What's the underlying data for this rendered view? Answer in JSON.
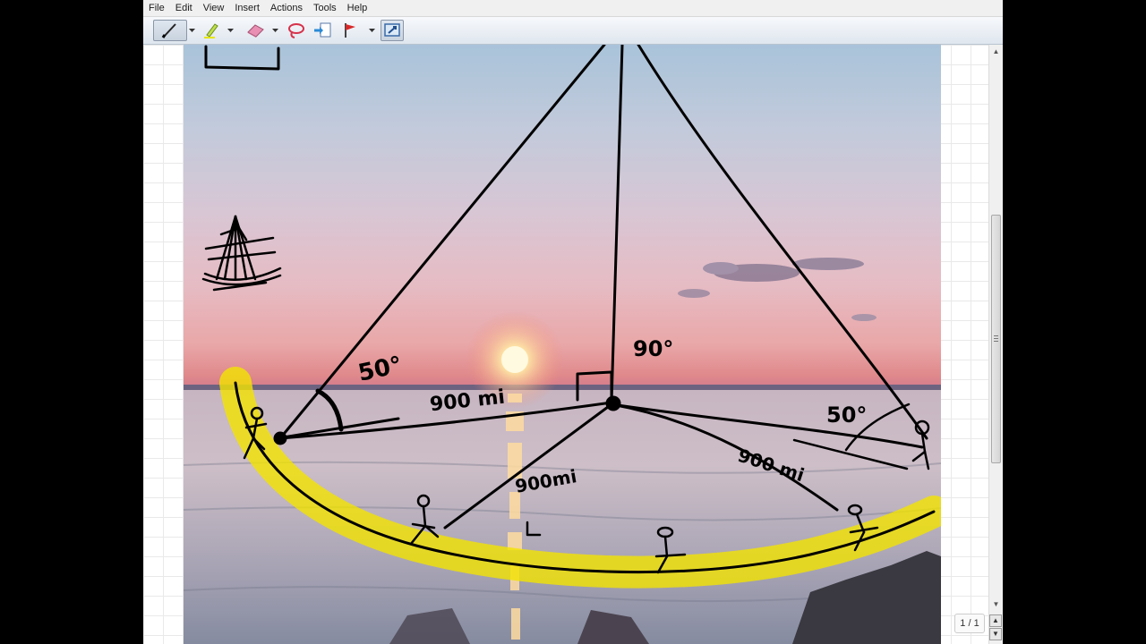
{
  "menu": [
    "File",
    "Edit",
    "View",
    "Insert",
    "Actions",
    "Tools",
    "Help"
  ],
  "toolbar": {
    "tools": [
      "pen-icon",
      "highlighter-icon",
      "eraser-icon",
      "lasso-icon",
      "insert-page-icon",
      "flag-icon",
      "screen-capture-icon"
    ]
  },
  "annotations": {
    "angle_left": "50°",
    "angle_right": "50°",
    "angle_top": "90°",
    "dist_top_left": "900 mi",
    "dist_bottom": "900mi",
    "dist_right": "900 mi",
    "label_L": "L"
  },
  "colors": {
    "ink": "#000000",
    "highlight": "#f2e400",
    "sun": "#fff6c8"
  },
  "page": {
    "indicator": "1 / 1"
  }
}
